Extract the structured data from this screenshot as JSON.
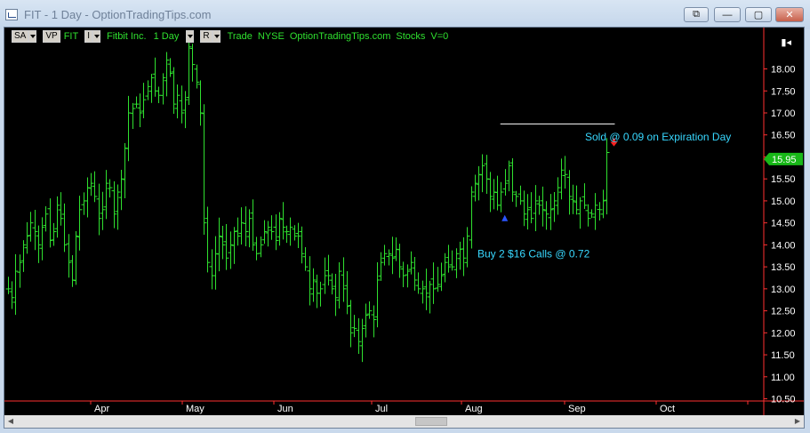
{
  "window": {
    "title": "FIT - 1 Day - OptionTradingTips.com",
    "restore_label": "⧉",
    "minimize_label": "—",
    "maximize_label": "▢",
    "close_label": "✕"
  },
  "toolbar": {
    "sa": "SA",
    "vp": "VP",
    "symbol": "FIT",
    "i_btn": "I",
    "company": "Fitbit Inc.",
    "interval": "1 Day",
    "r_btn": "R",
    "type": "Trade",
    "exchange": "NYSE",
    "source": "OptionTradingTips.com",
    "category": "Stocks",
    "volume": "V=0"
  },
  "colors": {
    "bars": "#2fe02f",
    "annotation": "#38d8ff",
    "price_tag": "#18b818",
    "buy_marker": "#2b55ff",
    "sell_marker": "#ff2020",
    "axis": "#ff3030"
  },
  "chart_data": {
    "type": "ohlc",
    "symbol": "FIT",
    "interval": "1 Day",
    "ylim": [
      10.45,
      18.9
    ],
    "y_ticks": [
      "18.00",
      "17.50",
      "17.00",
      "16.50",
      "16.00",
      "15.50",
      "15.00",
      "14.50",
      "14.00",
      "13.50",
      "13.00",
      "12.50",
      "12.00",
      "11.50",
      "11.00",
      "10.50"
    ],
    "x_ticks": [
      "Apr",
      "May",
      "Jun",
      "Jul",
      "Aug",
      "Sep",
      "Oct"
    ],
    "last_price": "15.95",
    "annotations": [
      {
        "text": "Sold @ 0.09 on Expiration Day",
        "price": 16.45
      },
      {
        "text": "Buy 2 $16 Calls @ 0.72",
        "price": 13.8
      }
    ],
    "markers": [
      {
        "type": "buy",
        "bar": 132,
        "price": 14.6
      },
      {
        "type": "sell",
        "bar": 161,
        "price": 16.3
      }
    ],
    "reference_line": {
      "price": 16.75,
      "from_bar": 132,
      "to_bar": 161
    },
    "closes": [
      13.0,
      12.8,
      13.4,
      13.6,
      14.0,
      14.2,
      14.5,
      14.3,
      14.0,
      14.4,
      14.7,
      14.1,
      14.3,
      14.9,
      14.6,
      14.0,
      13.6,
      13.2,
      14.2,
      14.8,
      15.0,
      15.3,
      15.4,
      15.1,
      14.6,
      14.8,
      15.4,
      15.3,
      14.7,
      15.2,
      15.5,
      16.2,
      17.0,
      17.1,
      17.2,
      17.0,
      17.3,
      17.6,
      17.8,
      17.5,
      17.4,
      17.8,
      18.2,
      17.9,
      17.2,
      17.4,
      17.0,
      17.3,
      18.5,
      18.1,
      17.7,
      17.0,
      14.5,
      13.6,
      13.3,
      13.8,
      14.2,
      14.0,
      13.7,
      14.0,
      14.3,
      14.2,
      14.5,
      14.3,
      14.6,
      14.0,
      13.8,
      14.0,
      14.3,
      14.4,
      14.3,
      14.1,
      14.6,
      14.4,
      14.3,
      14.4,
      14.2,
      14.2,
      13.8,
      13.5,
      13.0,
      13.2,
      12.9,
      13.0,
      13.3,
      13.3,
      13.0,
      12.8,
      13.4,
      13.0,
      12.6,
      12.0,
      12.1,
      11.8,
      12.1,
      12.4,
      12.5,
      12.3,
      13.2,
      13.6,
      13.8,
      13.8,
      13.7,
      13.9,
      13.5,
      13.3,
      13.4,
      13.6,
      13.2,
      13.0,
      13.0,
      12.9,
      13.1,
      13.0,
      13.1,
      13.3,
      13.6,
      13.5,
      13.5,
      13.8,
      13.9,
      13.7,
      14.2,
      15.2,
      15.4,
      15.6,
      15.8,
      15.5,
      15.1,
      15.2,
      14.9,
      15.2,
      15.4,
      15.8,
      15.2,
      15.1,
      15.0,
      14.7,
      14.8,
      14.6,
      15.0,
      14.9,
      14.8,
      14.7,
      14.8,
      15.0,
      15.3,
      15.7,
      15.6,
      15.1,
      15.0,
      14.8,
      15.0,
      14.9,
      14.6,
      14.7,
      14.9,
      14.8,
      15.0,
      16.1
    ]
  }
}
